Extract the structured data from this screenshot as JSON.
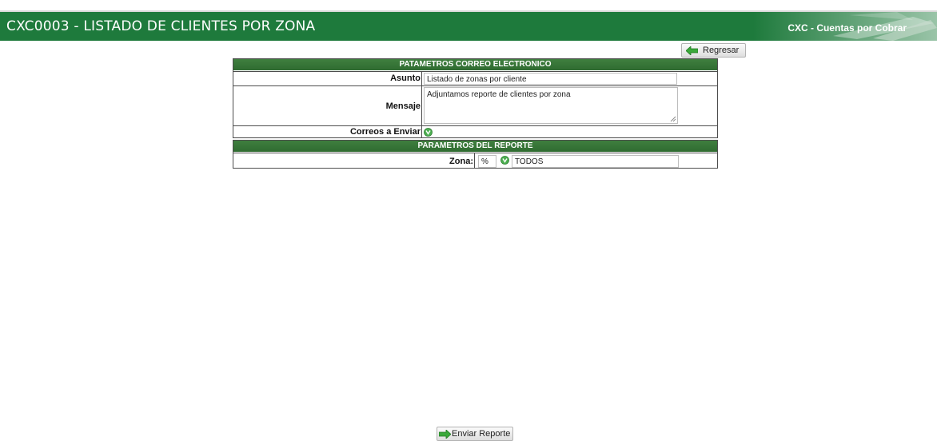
{
  "header": {
    "title": "CXC0003 - LISTADO DE CLIENTES POR ZONA",
    "module": "CXC - Cuentas por Cobrar"
  },
  "toolbar": {
    "back_label": "Regresar",
    "send_label": "Enviar Reporte"
  },
  "email_section": {
    "title": "PATAMETROS CORREO ELECTRONICO",
    "subject_label": "Asunto",
    "subject_value": "Listado de zonas por cliente",
    "message_label": "Mensaje",
    "message_value": "Adjuntamos reporte de clientes por zona",
    "recipients_label": "Correos a Enviar"
  },
  "report_section": {
    "title": "PARAMETROS DEL REPORTE",
    "zone_label": "Zona:",
    "zone_code": "%",
    "zone_name": "TODOS"
  },
  "colors": {
    "header_bg": "#1e7a3c",
    "section_header_bg": "#3a7a3a",
    "arrow_green": "#3aa83a"
  },
  "icons": {
    "back": "arrow-left-icon",
    "send": "arrow-right-icon",
    "lookup": "green-lookup-icon"
  }
}
